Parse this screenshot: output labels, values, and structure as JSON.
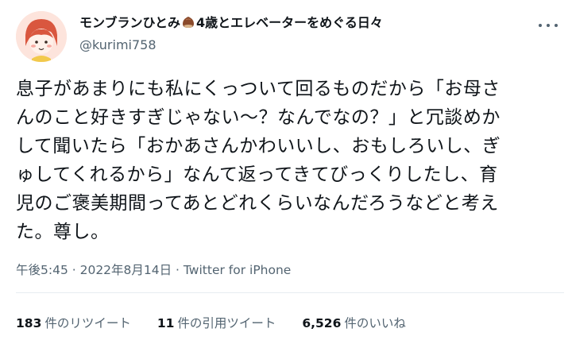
{
  "user": {
    "name_part1": "モンブランひとみ",
    "name_part2": "4歳とエレベーターをめぐる日々",
    "handle": "@kurimi758",
    "avatar_icon": "avatar-girl-icon",
    "name_emoji_icon": "chestnut-icon"
  },
  "tweet": {
    "text": "息子があまりにも私にくっついて回るものだから「お母さ\nんのこと好きすぎじゃない〜？なんでなの？」と冗談めか\nして聞いたら「おかあさんかわいいし、おもしろいし、ぎ\nゅしてくれるから」なんて返ってきてびっくりしたし、育\n児のご褒美期間ってあとどれくらいなんだろうなどと考え\nた。尊し。",
    "time": "午後5:45",
    "separator1": " · ",
    "date": "2022年8月14日",
    "separator2": " · ",
    "source": "Twitter for iPhone"
  },
  "stats": {
    "retweets_count": "183",
    "retweets_label": "件のリツイート",
    "quotes_count": "11",
    "quotes_label": "件の引用ツイート",
    "likes_count": "6,526",
    "likes_label": "件のいいね"
  },
  "colors": {
    "text": "#0f1419",
    "secondary": "#536471",
    "divider": "#e6ecf0",
    "avatar_bg": "#fde4dc"
  }
}
